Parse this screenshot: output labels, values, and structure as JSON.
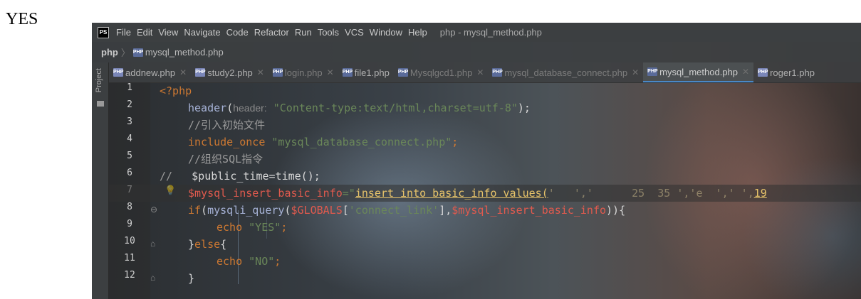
{
  "output_text": "YES",
  "menubar": {
    "logo": "PS",
    "items": [
      "File",
      "Edit",
      "View",
      "Navigate",
      "Code",
      "Refactor",
      "Run",
      "Tools",
      "VCS",
      "Window",
      "Help"
    ],
    "window_title": "php - mysql_method.php"
  },
  "breadcrumb": {
    "root": "php",
    "file": "mysql_method.php"
  },
  "sidebar": {
    "project_label": "Project"
  },
  "tabs": [
    {
      "label": "addnew.php",
      "closable": true,
      "dim": false
    },
    {
      "label": "study2.php",
      "closable": true,
      "dim": false
    },
    {
      "label": "login.php",
      "closable": true,
      "dim": true
    },
    {
      "label": "file1.php",
      "closable": false,
      "dim": false
    },
    {
      "label": "Mysqlgcd1.php",
      "closable": true,
      "dim": true
    },
    {
      "label": "mysql_database_connect.php",
      "closable": true,
      "dim": true
    },
    {
      "label": "mysql_method.php",
      "closable": true,
      "dim": false,
      "active": true
    },
    {
      "label": "roger1.php",
      "closable": false,
      "dim": false
    }
  ],
  "line_numbers": [
    "1",
    "2",
    "3",
    "4",
    "5",
    "6",
    "7",
    "8",
    "9",
    "10",
    "11",
    "12"
  ],
  "code": {
    "l1": "<?php",
    "l2_fn": "header",
    "l2_open": "(",
    "l2_hint": "header:",
    "l2_str": "\"Content-type:text/html,charset=utf-8\"",
    "l2_close": ");",
    "l3": "//引入初始文件",
    "l4_kw": "include_once",
    "l4_str": "\"mysql_database_connect.php\"",
    "l4_end": ";",
    "l5": "//组织SQL指令",
    "l6_cmt": "//",
    "l6_code": "$public_time=time();",
    "l7_var": "$mysql_insert_basic_info",
    "l7_eq": "=\"",
    "l7_sql": "insert into basic_info values(",
    "l7_blur": "'   ','      25  35 ','e  ',' ',",
    "l7_tail": "19",
    "l8_if": "if",
    "l8_open": "(",
    "l8_fn": "mysqli_query",
    "l8_paren": "(",
    "l8_globals": "$GLOBALS",
    "l8_bracket": "[",
    "l8_key": "'connect_link'",
    "l8_close": "],",
    "l8_var": "$mysql_insert_basic_info",
    "l8_end": ")){",
    "l9_kw": "echo",
    "l9_str": "\"YES\"",
    "l9_end": ";",
    "l10_close": "}",
    "l10_kw": "else",
    "l10_open": "{",
    "l11_kw": "echo",
    "l11_str": "\"NO\"",
    "l11_end": ";",
    "l12": "}"
  },
  "icons": {
    "bulb": "lightbulb-icon",
    "folder": "folder-icon"
  },
  "colors": {
    "keyword": "#cc7832",
    "string": "#6a8759",
    "variable": "#e05a4e",
    "function": "#a6b2d6"
  }
}
